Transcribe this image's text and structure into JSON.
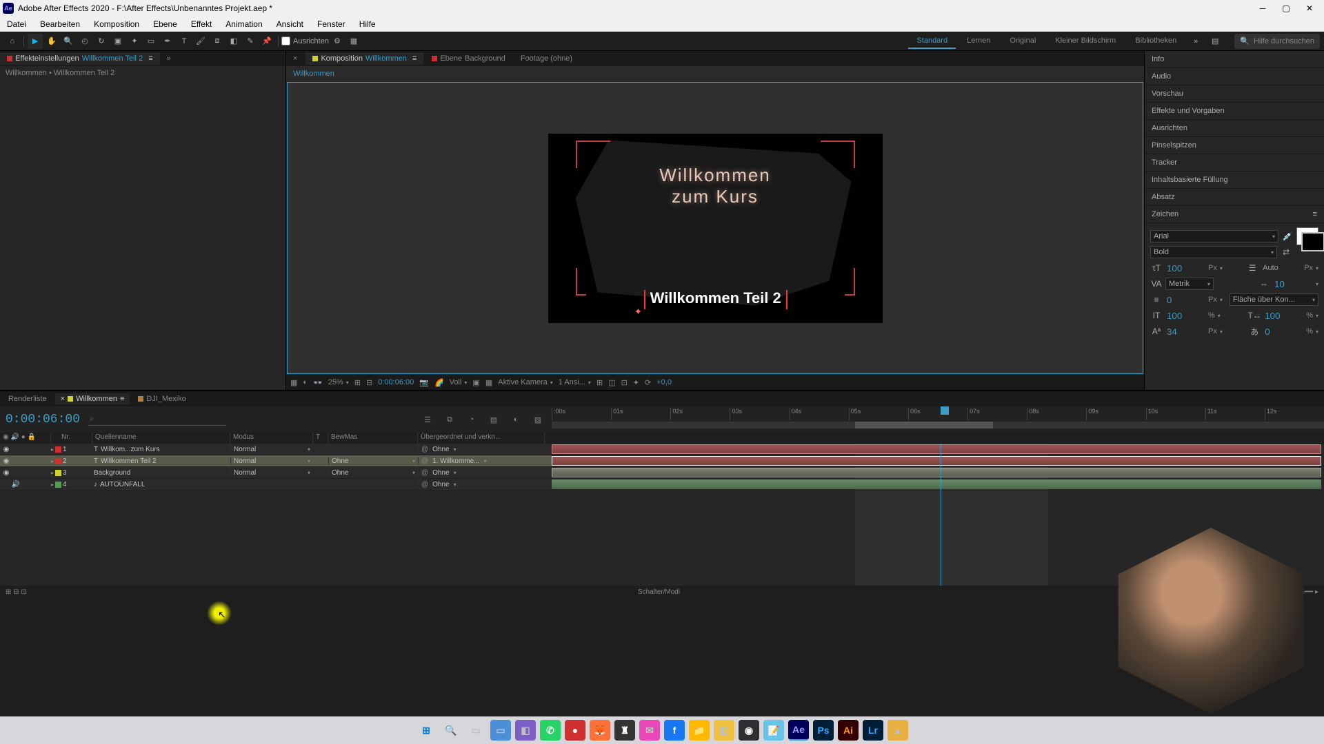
{
  "titlebar": {
    "app_abbrev": "Ae",
    "text": "Adobe After Effects 2020 - F:\\After Effects\\Unbenanntes Projekt.aep *"
  },
  "menu": [
    "Datei",
    "Bearbeiten",
    "Komposition",
    "Ebene",
    "Effekt",
    "Animation",
    "Ansicht",
    "Fenster",
    "Hilfe"
  ],
  "toolbar": {
    "ausrichten": "Ausrichten"
  },
  "workspaces": {
    "items": [
      "Standard",
      "Lernen",
      "Original",
      "Kleiner Bildschirm",
      "Bibliotheken"
    ],
    "active": "Standard",
    "search_placeholder": "Hilfe durchsuchen"
  },
  "left_panel": {
    "tab1": "Effekteinstellungen",
    "tab1_link": "Willkommen Teil 2",
    "breadcrumb": "Willkommen • Willkommen Teil 2"
  },
  "comp_tabs": {
    "komposition": "Komposition",
    "komp_name": "Willkommen",
    "ebene": "Ebene",
    "ebene_name": "Background",
    "footage": "Footage  (ohne)",
    "crumb": "Willkommen"
  },
  "canvas": {
    "title_line1": "Willkommen",
    "title_line2": "zum Kurs",
    "subtitle": "Willkommen Teil 2"
  },
  "viewer_bar": {
    "zoom": "25%",
    "timecode": "0:00:06:00",
    "res": "Voll",
    "camera": "Aktive Kamera",
    "views": "1 Ansi...",
    "exposure": "+0,0"
  },
  "right_panels": [
    "Info",
    "Audio",
    "Vorschau",
    "Effekte und Vorgaben",
    "Ausrichten",
    "Pinselspitzen",
    "Tracker",
    "Inhaltsbasierte Füllung",
    "Absatz"
  ],
  "char_panel": {
    "title": "Zeichen",
    "font": "Arial",
    "style": "Bold",
    "size": "100",
    "size_unit": "Px",
    "leading_label": "Auto",
    "leading_unit": "Px",
    "kern": "Metrik",
    "tracking": "10",
    "stroke": "0",
    "stroke_unit": "Px",
    "stroke_mode": "Fläche über Kon...",
    "vscale": "100",
    "vscale_unit": "%",
    "hscale": "100",
    "hscale_unit": "%",
    "baseline": "34",
    "baseline_unit": "Px",
    "tsume": "0",
    "tsume_unit": "%"
  },
  "timeline": {
    "tabs": {
      "render": "Renderliste",
      "comp": "Willkommen",
      "dji": "DJI_Mexiko"
    },
    "timecode": "0:00:06:00",
    "search_ph": "⌕",
    "columns": {
      "nr": "Nr.",
      "name": "Quellenname",
      "mode": "Modus",
      "t": "T",
      "bew": "BewMas",
      "parent": "Übergeordnet und verkn..."
    },
    "layers": [
      {
        "nr": "1",
        "color": "#d03030",
        "icon": "T",
        "name": "Willkom...zum Kurs",
        "mode": "Normal",
        "bew": "",
        "parent": "Ohne"
      },
      {
        "nr": "2",
        "color": "#d03030",
        "icon": "T",
        "name": "Willkommen Teil 2",
        "mode": "Normal",
        "bew": "Ohne",
        "parent": "1. Willkomme..."
      },
      {
        "nr": "3",
        "color": "#d0d030",
        "icon": "",
        "name": "Background",
        "mode": "Normal",
        "bew": "Ohne",
        "parent": "Ohne"
      },
      {
        "nr": "4",
        "color": "#50a050",
        "icon": "♪",
        "name": "AUTOUNFALL",
        "mode": "",
        "bew": "",
        "parent": "Ohne"
      }
    ],
    "ruler": [
      ":00s",
      "01s",
      "02s",
      "03s",
      "04s",
      "05s",
      "06s",
      "07s",
      "08s",
      "09s",
      "10s",
      "11s",
      "12s"
    ],
    "footer": "Schalter/Modi"
  }
}
